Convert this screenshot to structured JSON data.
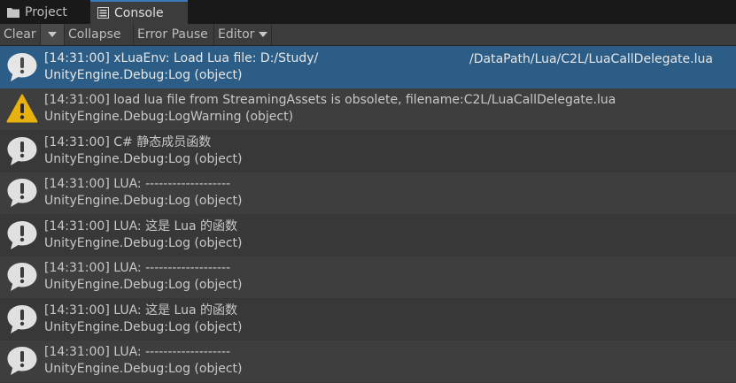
{
  "tabs": [
    {
      "label": "Project",
      "icon": "folder-icon"
    },
    {
      "label": "Console",
      "icon": "console-icon"
    }
  ],
  "toolbar": {
    "clear_label": "Clear",
    "collapse_label": "Collapse",
    "error_pause_label": "Error Pause",
    "editor_label": "Editor"
  },
  "entries": [
    {
      "line1": "[14:31:00] xLuaEnv: Load Lua file: D:/Study/",
      "line1_right": "/DataPath/Lua/C2L/LuaCallDelegate.lua",
      "line2": "UnityEngine.Debug:Log (object)",
      "type": "info",
      "selected": true
    },
    {
      "line1": "[14:31:00] load lua file from StreamingAssets is obsolete, filename:C2L/LuaCallDelegate.lua",
      "line2": "UnityEngine.Debug:LogWarning (object)",
      "type": "warning"
    },
    {
      "line1": "[14:31:00] C# 静态成员函数",
      "line2": "UnityEngine.Debug:Log (object)",
      "type": "info"
    },
    {
      "line1": "[14:31:00] LUA: -------------------",
      "line2": "UnityEngine.Debug:Log (object)",
      "type": "info"
    },
    {
      "line1": "[14:31:00] LUA: 这是 Lua 的函数",
      "line2": "UnityEngine.Debug:Log (object)",
      "type": "info"
    },
    {
      "line1": "[14:31:00] LUA: -------------------",
      "line2": "UnityEngine.Debug:Log (object)",
      "type": "info"
    },
    {
      "line1": "[14:31:00] LUA: 这是 Lua 的函数",
      "line2": "UnityEngine.Debug:Log (object)",
      "type": "info"
    },
    {
      "line1": "[14:31:00] LUA: -------------------",
      "line2": "UnityEngine.Debug:Log (object)",
      "type": "info"
    }
  ],
  "colors": {
    "selected_row": "#2c5d87",
    "warning": "#e8b10e",
    "info_icon": "#e6e6e6"
  }
}
